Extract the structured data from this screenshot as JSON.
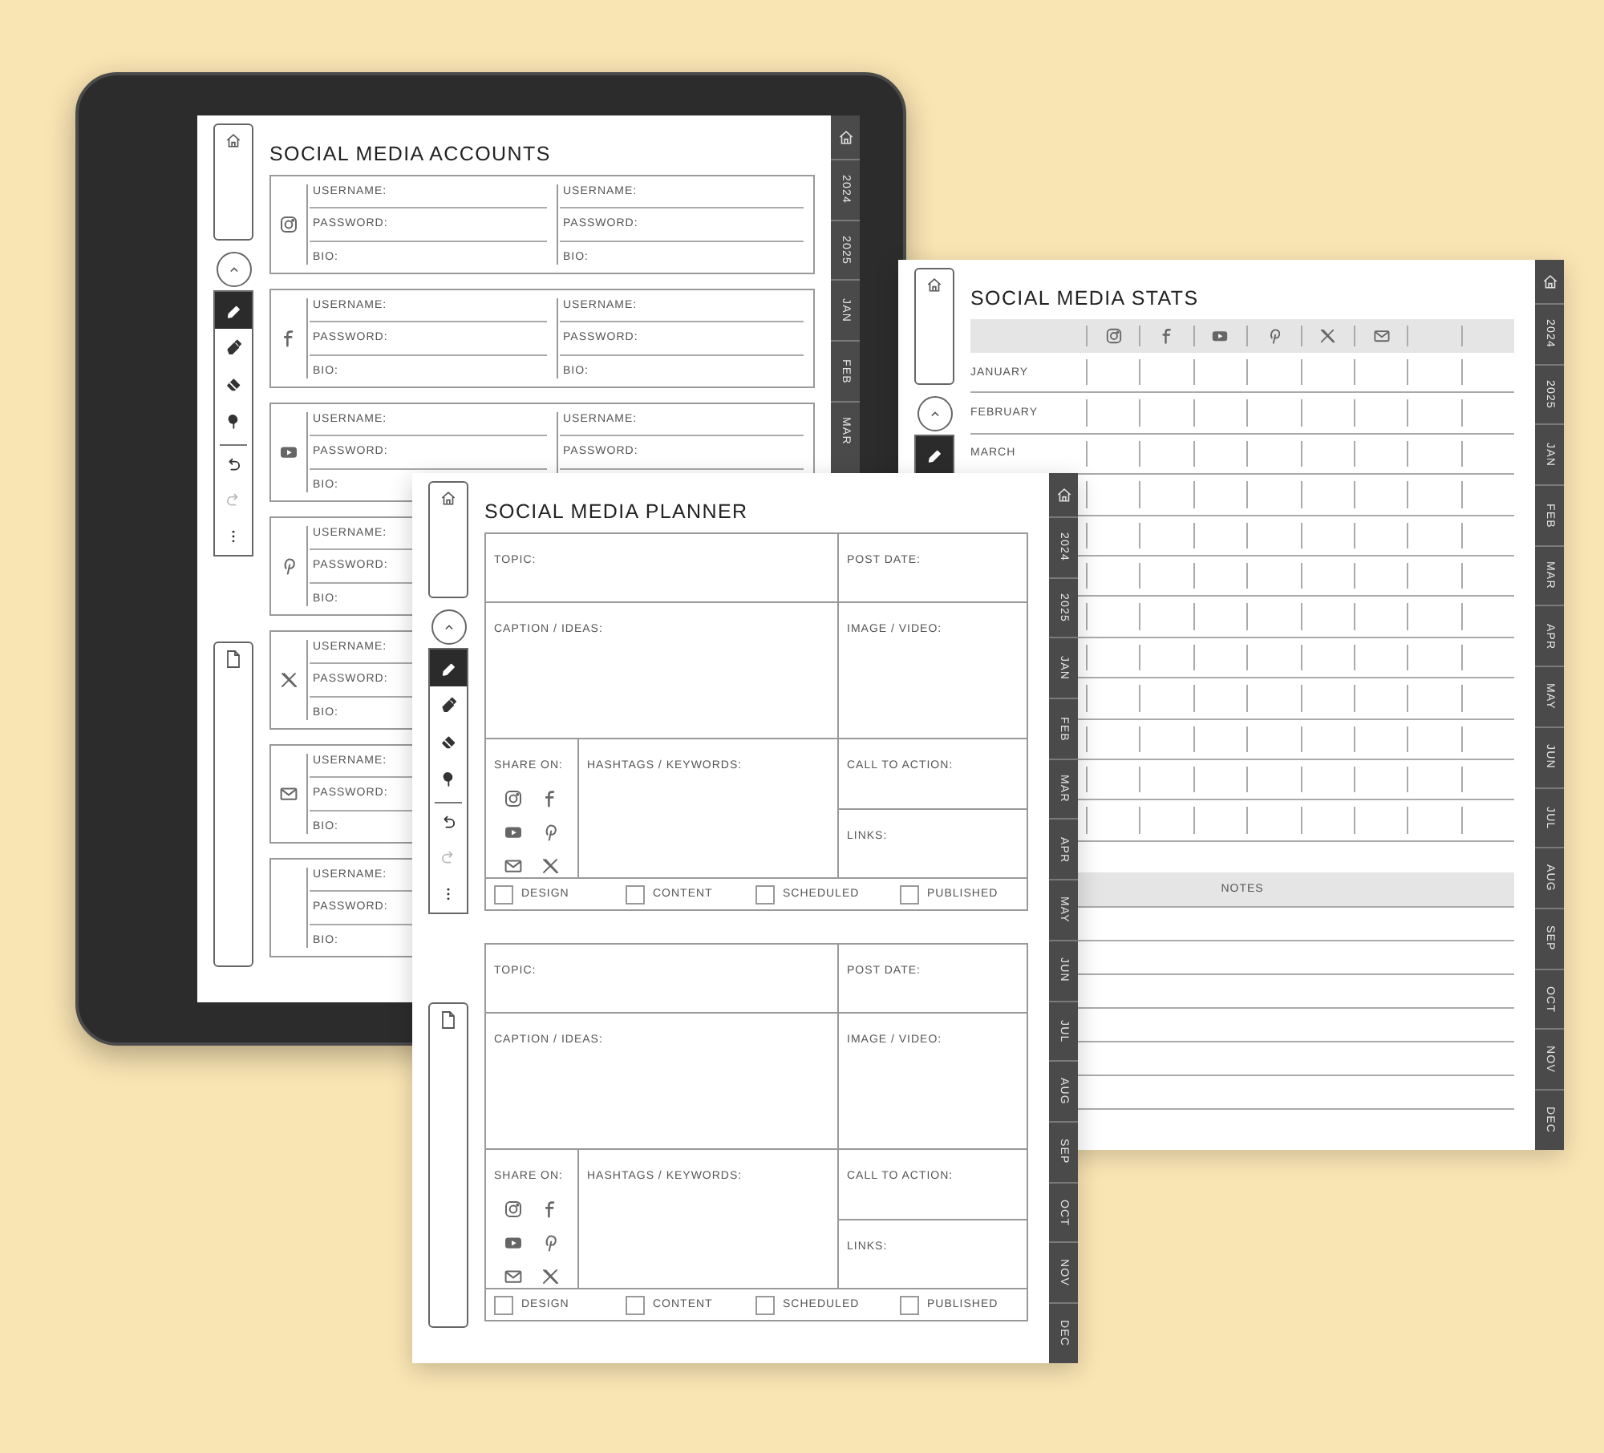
{
  "pages": [
    {
      "kind": "accounts",
      "title": "SOCIAL MEDIA ACCOUNTS",
      "page_panel": true,
      "tools": [
        {
          "kind": "pen",
          "selected": true
        },
        {
          "kind": "marker",
          "selected": false
        },
        {
          "kind": "eraser",
          "selected": false
        },
        {
          "kind": "brush",
          "selected": false
        },
        {
          "kind": "undo",
          "selected": false
        },
        {
          "kind": "redo",
          "selected": false
        },
        {
          "kind": "more",
          "selected": false
        }
      ],
      "tabs": [
        "2024",
        "2025",
        "JAN",
        "FEB",
        "MAR"
      ],
      "cards": [
        {
          "left": [
            "USERNAME:",
            "PASSWORD:",
            "BIO:"
          ],
          "right": [
            "USERNAME:",
            "PASSWORD:",
            "BIO:"
          ]
        },
        {
          "left": [
            "USERNAME:",
            "PASSWORD:",
            "BIO:"
          ],
          "right": [
            "USERNAME:",
            "PASSWORD:",
            "BIO:"
          ]
        },
        {
          "left": [
            "USERNAME:",
            "PASSWORD:",
            "BIO:"
          ],
          "right": [
            "USERNAME:",
            "PASSWORD:"
          ]
        },
        {
          "left": [
            "USERNAME:",
            "PASSWORD:",
            "BIO:"
          ]
        },
        {
          "left": [
            "USERNAME:",
            "PASSWORD:",
            "BIO:"
          ]
        },
        {
          "left": [
            "USERNAME:",
            "PASSWORD:",
            "BIO:"
          ]
        },
        {
          "left": [
            "USERNAME:",
            "PASSWORD:",
            "BIO:"
          ]
        }
      ]
    },
    {
      "kind": "stats",
      "title": "SOCIAL MEDIA STATS",
      "tools": [
        {
          "kind": "pen",
          "selected": true
        }
      ],
      "tabs": [
        "2024",
        "2025",
        "JAN",
        "FEB",
        "MAR",
        "APR",
        "MAY",
        "JUN",
        "JUL",
        "AUG",
        "SEP",
        "OCT",
        "NOV",
        "DEC"
      ],
      "rows": [
        "JANUARY",
        "FEBRUARY",
        "MARCH"
      ],
      "notes": "NOTES"
    },
    {
      "kind": "planner",
      "title": "SOCIAL MEDIA PLANNER",
      "page_panel": true,
      "tools": [
        {
          "kind": "pen",
          "selected": true
        },
        {
          "kind": "marker",
          "selected": false
        },
        {
          "kind": "eraser",
          "selected": false
        },
        {
          "kind": "brush",
          "selected": false
        },
        {
          "kind": "undo",
          "selected": false
        },
        {
          "kind": "redo",
          "selected": false
        },
        {
          "kind": "more",
          "selected": false
        }
      ],
      "tabs": [
        "2024",
        "2025",
        "JAN",
        "FEB",
        "MAR",
        "APR",
        "MAY",
        "JUN",
        "JUL",
        "AUG",
        "SEP",
        "OCT",
        "NOV",
        "DEC"
      ],
      "blocks": [
        {
          "topic": "TOPIC:",
          "post_date": "POST DATE:",
          "caption": "CAPTION / IDEAS:",
          "image_video": "IMAGE / VIDEO:",
          "share_on": "SHARE ON:",
          "hashtags": "HASHTAGS / KEYWORDS:",
          "call_to_action": "CALL TO ACTION:",
          "links": "LINKS:",
          "checkboxes": [
            {
              "label": "DESIGN",
              "checked": false
            },
            {
              "label": "CONTENT",
              "checked": false
            },
            {
              "label": "SCHEDULED",
              "checked": false
            },
            {
              "label": "PUBLISHED",
              "checked": false
            }
          ]
        },
        {
          "topic": "TOPIC:",
          "post_date": "POST DATE:",
          "caption": "CAPTION / IDEAS:",
          "image_video": "IMAGE / VIDEO:",
          "share_on": "SHARE ON:",
          "hashtags": "HASHTAGS / KEYWORDS:",
          "call_to_action": "CALL TO ACTION:",
          "links": "LINKS:",
          "checkboxes": [
            {
              "label": "DESIGN",
              "checked": false
            },
            {
              "label": "CONTENT",
              "checked": false
            },
            {
              "label": "SCHEDULED",
              "checked": false
            },
            {
              "label": "PUBLISHED",
              "checked": false
            }
          ]
        }
      ]
    }
  ]
}
